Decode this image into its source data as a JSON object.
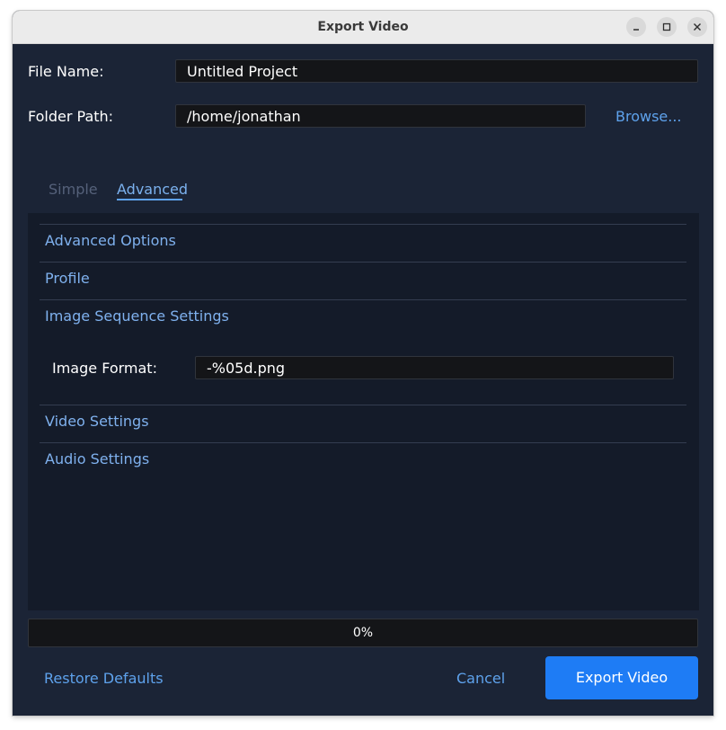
{
  "window": {
    "title": "Export Video",
    "controls": [
      "minimize-icon",
      "maximize-icon",
      "close-icon"
    ]
  },
  "form": {
    "file_name_label": "File Name:",
    "file_name_value": "Untitled Project",
    "folder_path_label": "Folder Path:",
    "folder_path_value": "/home/jonathan",
    "browse_label": "Browse..."
  },
  "tabs": [
    {
      "label": "Simple",
      "active": false
    },
    {
      "label": "Advanced",
      "active": true
    }
  ],
  "sections": [
    {
      "label": "Advanced Options",
      "expanded": false
    },
    {
      "label": "Profile",
      "expanded": false
    },
    {
      "label": "Image Sequence Settings",
      "expanded": true
    },
    {
      "label": "Video Settings",
      "expanded": false
    },
    {
      "label": "Audio Settings",
      "expanded": false
    }
  ],
  "image_sequence": {
    "format_label": "Image Format:",
    "format_value": "-%05d.png"
  },
  "progress": {
    "value": 0,
    "text": "0%"
  },
  "footer": {
    "restore_label": "Restore Defaults",
    "cancel_label": "Cancel",
    "export_label": "Export Video"
  },
  "colors": {
    "background": "#1b2436",
    "panel": "#141b29",
    "accent": "#1e7cf5",
    "link": "#5ea2ec"
  }
}
